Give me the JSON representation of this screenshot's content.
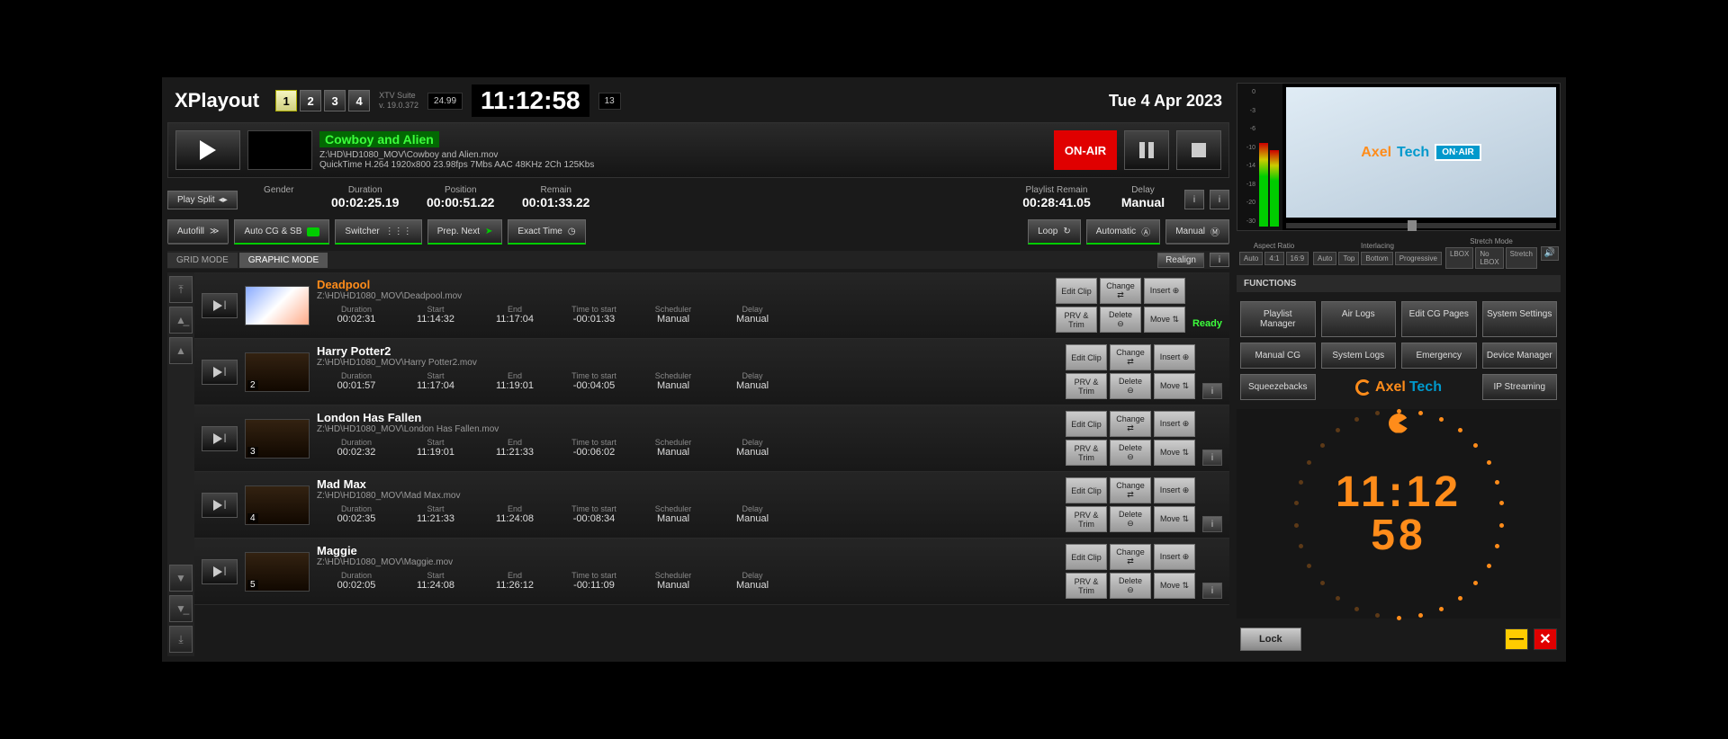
{
  "header": {
    "app_title": "XPlayout",
    "channels": [
      "1",
      "2",
      "3",
      "4"
    ],
    "active_channel": 0,
    "suite": "XTV Suite",
    "version": "v. 19.0.372",
    "tc_small1": "24.99",
    "tc_small2": "13",
    "timecode": "11:12:58",
    "date": "Tue 4 Apr 2023"
  },
  "nowplaying": {
    "title": "Cowboy and Alien",
    "path": "Z:\\HD\\HD1080_MOV\\Cowboy and Alien.mov",
    "codec": "QuickTime H.264 1920x800 23.98fps 7Mbs AAC 48KHz 2Ch 125Kbs",
    "onair": "ON-AIR"
  },
  "info": {
    "play_split": "Play Split",
    "gender_label": "Gender",
    "duration_label": "Duration",
    "duration": "00:02:25.19",
    "position_label": "Position",
    "position": "00:00:51.22",
    "remain_label": "Remain",
    "remain": "00:01:33.22",
    "plremain_label": "Playlist Remain",
    "plremain": "00:28:41.05",
    "delay_label": "Delay",
    "delay": "Manual"
  },
  "opts": {
    "autofill": "Autofill",
    "autocg": "Auto CG & SB",
    "switcher": "Switcher",
    "prepnext": "Prep. Next",
    "exacttime": "Exact Time",
    "loop": "Loop",
    "automatic": "Automatic",
    "manual": "Manual"
  },
  "tabs": {
    "grid": "GRID MODE",
    "graphic": "GRAPHIC MODE",
    "realign": "Realign"
  },
  "playlist_labels": {
    "duration": "Duration",
    "start": "Start",
    "end": "End",
    "tts": "Time to start",
    "scheduler": "Scheduler",
    "delay": "Delay"
  },
  "playlist_actions": {
    "edit": "Edit Clip",
    "change": "Change",
    "insert": "Insert",
    "prv": "PRV & Trim",
    "delete": "Delete",
    "move": "Move"
  },
  "playlist": [
    {
      "title": "Deadpool",
      "path": "Z:\\HD\\HD1080_MOV\\Deadpool.mov",
      "duration": "00:02:31",
      "start": "11:14:32",
      "end": "11:17:04",
      "tts": "-00:01:33",
      "scheduler": "Manual",
      "delay": "Manual",
      "ready": "Ready",
      "next": true,
      "thumb": "light",
      "num": ""
    },
    {
      "title": "Harry Potter2",
      "path": "Z:\\HD\\HD1080_MOV\\Harry Potter2.mov",
      "duration": "00:01:57",
      "start": "11:17:04",
      "end": "11:19:01",
      "tts": "-00:04:05",
      "scheduler": "Manual",
      "delay": "Manual",
      "ready": "",
      "next": false,
      "thumb": "dark",
      "num": "2"
    },
    {
      "title": "London Has Fallen",
      "path": "Z:\\HD\\HD1080_MOV\\London Has Fallen.mov",
      "duration": "00:02:32",
      "start": "11:19:01",
      "end": "11:21:33",
      "tts": "-00:06:02",
      "scheduler": "Manual",
      "delay": "Manual",
      "ready": "",
      "next": false,
      "thumb": "dark",
      "num": "3"
    },
    {
      "title": "Mad Max",
      "path": "Z:\\HD\\HD1080_MOV\\Mad Max.mov",
      "duration": "00:02:35",
      "start": "11:21:33",
      "end": "11:24:08",
      "tts": "-00:08:34",
      "scheduler": "Manual",
      "delay": "Manual",
      "ready": "",
      "next": false,
      "thumb": "dark",
      "num": "4"
    },
    {
      "title": "Maggie",
      "path": "Z:\\HD\\HD1080_MOV\\Maggie.mov",
      "duration": "00:02:05",
      "start": "11:24:08",
      "end": "11:26:12",
      "tts": "-00:11:09",
      "scheduler": "Manual",
      "delay": "Manual",
      "ready": "",
      "next": false,
      "thumb": "dark",
      "num": "5"
    }
  ],
  "vu_scale": [
    "0",
    "-3",
    "-6",
    "-10",
    "-14",
    "-18",
    "-20",
    "-30"
  ],
  "preview": {
    "aspect": "Aspect Ratio",
    "aspect_opts": [
      "Auto",
      "4:1",
      "16:9"
    ],
    "interlacing": "Interlacing",
    "interlacing_opts": [
      "Auto",
      "Top",
      "Bottom",
      "Progressive"
    ],
    "stretch": "Stretch Mode",
    "stretch_opts": [
      "LBOX",
      "No LBOX",
      "Stretch"
    ],
    "onair_badge": "ON·AIR",
    "logo_axel": "Axel",
    "logo_tech": "Tech"
  },
  "functions_hdr": "FUNCTIONS",
  "functions": [
    "Playlist Manager",
    "Air Logs",
    "Edit CG Pages",
    "System Settings",
    "Manual CG",
    "System Logs",
    "Emergency",
    "Device Manager",
    "Squeezebacks",
    "",
    "",
    "IP Streaming"
  ],
  "axellogo": {
    "axel": "Axel",
    "tech": "Tech"
  },
  "clock": {
    "line1": "11:12",
    "line2": "58"
  },
  "bottom": {
    "lock": "Lock"
  }
}
